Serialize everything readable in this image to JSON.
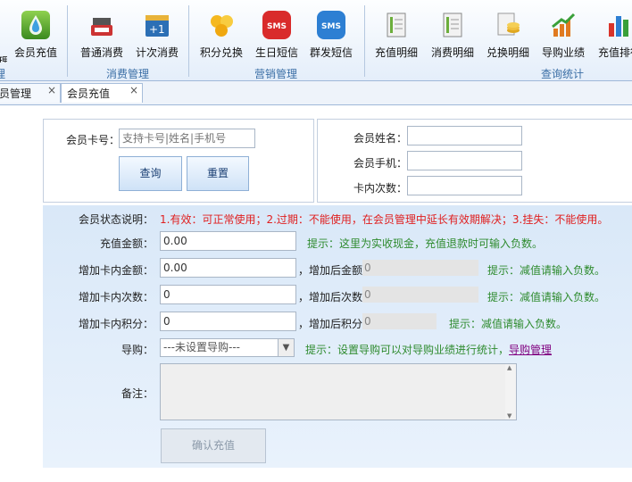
{
  "ribbon": {
    "partial_left": "理",
    "buttons": [
      {
        "label": "会员充值",
        "icon": "water-drop-icon"
      },
      {
        "label": "普通消费",
        "icon": "cash-register-icon"
      },
      {
        "label": "计次消费",
        "icon": "calendar-plus-icon"
      },
      {
        "label": "积分兑换",
        "icon": "hexagon-points-icon"
      },
      {
        "label": "生日短信",
        "icon": "sms-red-icon"
      },
      {
        "label": "群发短信",
        "icon": "sms-blue-icon"
      },
      {
        "label": "充值明细",
        "icon": "ledger-icon"
      },
      {
        "label": "消费明细",
        "icon": "ledger-icon"
      },
      {
        "label": "兑换明细",
        "icon": "coins-icon"
      },
      {
        "label": "导购业绩",
        "icon": "growth-chart-icon"
      },
      {
        "label": "充值排行",
        "icon": "bar-chart-icon"
      }
    ],
    "groups": [
      {
        "label": "理"
      },
      {
        "label": "消费管理"
      },
      {
        "label": "营销管理"
      },
      {
        "label": "查询统计"
      }
    ],
    "colors": {
      "accent": "#3a6ea5",
      "group_text": "#3a6ea5"
    }
  },
  "tabs": [
    {
      "label": "员管理",
      "close": "×"
    },
    {
      "label": "会员充值",
      "close": "×"
    }
  ],
  "search": {
    "card_label": "会员卡号：",
    "card_placeholder": "支持卡号|姓名|手机号",
    "query_button": "查询",
    "reset_button": "重置"
  },
  "info": {
    "name_label": "会员姓名：",
    "phone_label": "会员手机：",
    "times_label": "卡内次数："
  },
  "form": {
    "status_label": "会员状态说明：",
    "status_text": "1.有效：可正常使用；2.过期：不能使用，在会员管理中延长有效期解决；3.挂失：不能使用。",
    "amount_label": "充值金额：",
    "amount_value": "0.00",
    "amount_hint": "提示：这里为实收现金，充值退款时可输入负数。",
    "card_amount_label": "增加卡内金额：",
    "card_amount_value": "0.00",
    "after_amount_label": "，增加后金额",
    "after_amount_value": "0",
    "card_amount_hint": "提示：减值请输入负数。",
    "card_times_label": "增加卡内次数：",
    "card_times_value": "0",
    "after_times_label": "，增加后次数",
    "after_times_value": "0",
    "card_times_hint": "提示：减值请输入负数。",
    "card_points_label": "增加卡内积分：",
    "card_points_value": "0",
    "after_points_label": "，增加后积分",
    "after_points_value": "0",
    "card_points_hint": "提示：减值请输入负数。",
    "guide_label": "导购：",
    "guide_value": "---未设置导购---",
    "guide_hint": "提示：设置导购可以对导购业绩进行统计，",
    "guide_link": "导购管理",
    "notes_label": "备注：",
    "confirm_button": "确认充值"
  }
}
